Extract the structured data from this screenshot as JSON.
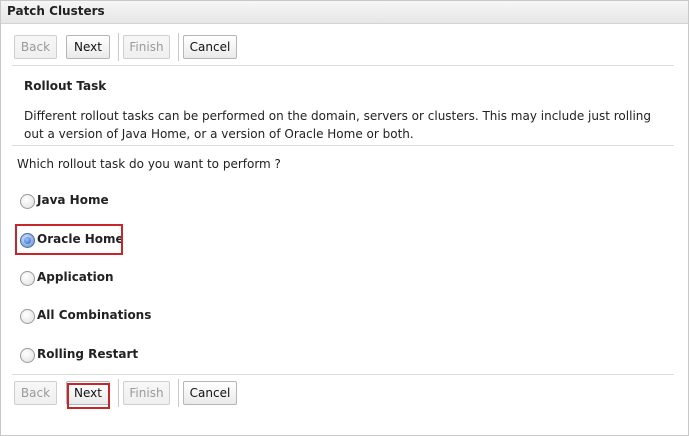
{
  "window": {
    "title": "Patch Clusters"
  },
  "toolbar": {
    "back_label": "Back",
    "next_label": "Next",
    "finish_label": "Finish",
    "cancel_label": "Cancel"
  },
  "section": {
    "title": "Rollout Task",
    "description": "Different rollout tasks can be performed on the domain, servers or clusters. This may include just rolling out a version of Java Home, or a version of Oracle Home or both."
  },
  "question": "Which rollout task do you want to perform ?",
  "options": [
    {
      "label": "Java Home",
      "selected": false
    },
    {
      "label": "Oracle Home",
      "selected": true
    },
    {
      "label": "Application",
      "selected": false
    },
    {
      "label": "All Combinations",
      "selected": false
    },
    {
      "label": "Rolling Restart",
      "selected": false
    }
  ],
  "colors": {
    "highlight": "#c8242b",
    "radio_selected": "#2d62b8"
  }
}
